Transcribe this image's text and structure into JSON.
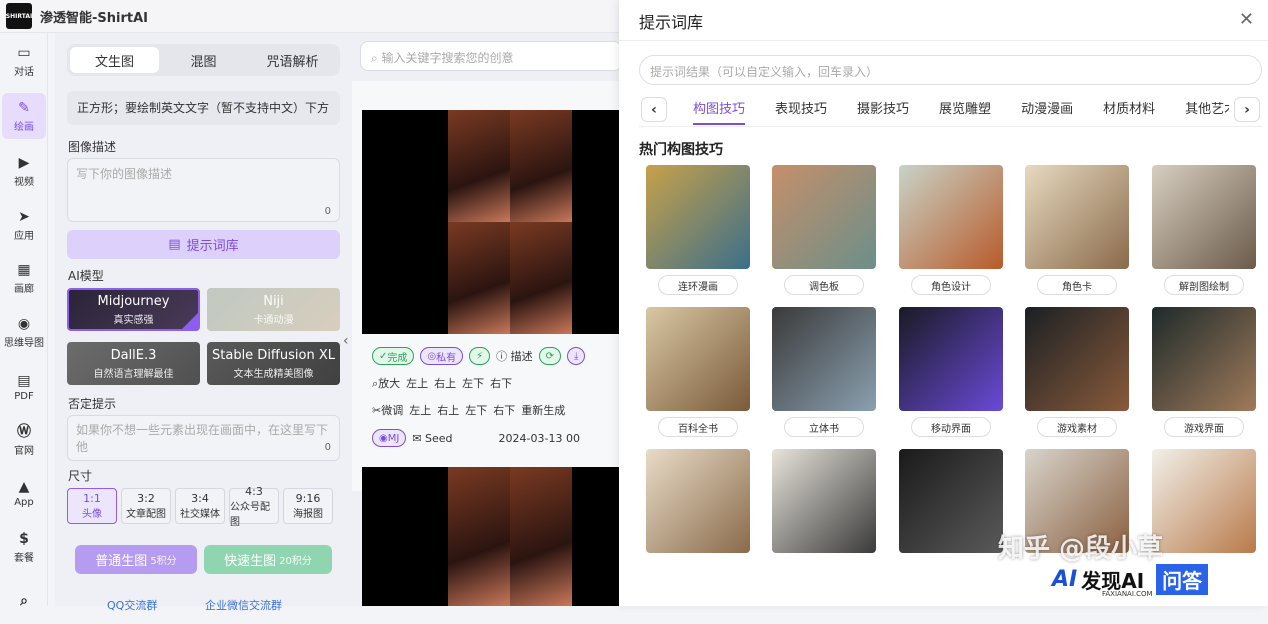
{
  "app": {
    "title": "渗透智能-ShirtAI",
    "logo_text": "SHIRTAI"
  },
  "nav": [
    {
      "label": "对话",
      "icon": "chat-icon",
      "glyph": "▭"
    },
    {
      "label": "绘画",
      "icon": "brush-icon",
      "glyph": "✎"
    },
    {
      "label": "视频",
      "icon": "video-icon",
      "glyph": "▶"
    },
    {
      "label": "应用",
      "icon": "rocket-icon",
      "glyph": "➤"
    },
    {
      "label": "画廊",
      "icon": "gallery-icon",
      "glyph": "▦"
    },
    {
      "label": "思维导图",
      "icon": "mindmap-icon",
      "glyph": "◉"
    },
    {
      "label": "PDF",
      "icon": "pdf-icon",
      "glyph": "▤"
    },
    {
      "label": "官网",
      "icon": "wordpress-icon",
      "glyph": "Ⓦ"
    },
    {
      "label": "App",
      "icon": "app-icon",
      "glyph": "▲"
    },
    {
      "label": "套餐",
      "icon": "package-icon",
      "glyph": "$"
    },
    {
      "label": "",
      "icon": "search-icon",
      "glyph": "⌕"
    }
  ],
  "panel": {
    "tabs": [
      "文生图",
      "混图",
      "咒语解析"
    ],
    "prompt_preview": "正方形；要绘制英文文字（暂不支持中文）下方",
    "image_desc_label": "图像描述",
    "image_desc_placeholder": "写下你的图像描述",
    "image_desc_count": "0",
    "library_button": "提示词库",
    "model_label": "AI模型",
    "models": [
      {
        "name": "Midjourney",
        "desc": "真实感强"
      },
      {
        "name": "Niji",
        "desc": "卡通动漫"
      },
      {
        "name": "DallE.3",
        "desc": "自然语言理解最佳"
      },
      {
        "name": "Stable Diffusion XL",
        "desc": "文本生成精美图像"
      }
    ],
    "negative_label": "否定提示",
    "negative_placeholder": "如果你不想一些元素出现在画面中，在这里写下他",
    "negative_count": "0",
    "size_label": "尺寸",
    "sizes": [
      {
        "ratio": "1:1",
        "desc": "头像"
      },
      {
        "ratio": "3:2",
        "desc": "文章配图"
      },
      {
        "ratio": "3:4",
        "desc": "社交媒体"
      },
      {
        "ratio": "4:3",
        "desc": "公众号配图"
      },
      {
        "ratio": "9:16",
        "desc": "海报图"
      }
    ],
    "gen_normal": "普通生图",
    "gen_normal_cost": "5积分",
    "gen_fast": "快速生图",
    "gen_fast_cost": "20积分",
    "contact_qq": "QQ交流群",
    "contact_wechat": "企业微信交流群"
  },
  "main": {
    "search_placeholder": "输入关键字搜索您的创意",
    "status_done": "完成",
    "status_private": "私有",
    "describe": "描述",
    "zoom": "放大",
    "finetune": "微调",
    "dirs": [
      "左上",
      "右上",
      "左下",
      "右下"
    ],
    "regen": "重新生成",
    "mj": "MJ",
    "seed": "Seed",
    "date": "2024-03-13 00"
  },
  "drawer": {
    "title": "提示词库",
    "search_placeholder": "提示词结果（可以自定义输入，回车录入）",
    "categories": [
      "构图技巧",
      "表现技巧",
      "摄影技巧",
      "展览雕塑",
      "动漫漫画",
      "材质材料",
      "其他艺术"
    ],
    "section_title": "热门构图技巧",
    "items": [
      {
        "label": "连环漫画",
        "c1": "#c8a14a",
        "c2": "#3a6f8a"
      },
      {
        "label": "调色板",
        "c1": "#c58f6a",
        "c2": "#6b8f8a"
      },
      {
        "label": "角色设计",
        "c1": "#c9d3c7",
        "c2": "#b85a2a"
      },
      {
        "label": "角色卡",
        "c1": "#e6d9c0",
        "c2": "#8a6a4a"
      },
      {
        "label": "解剖图绘制",
        "c1": "#d8cfc0",
        "c2": "#6a5a4a"
      },
      {
        "label": "百科全书",
        "c1": "#d9c7a4",
        "c2": "#7a5a3a"
      },
      {
        "label": "立体书",
        "c1": "#3a3a3a",
        "c2": "#8aa0b0"
      },
      {
        "label": "移动界面",
        "c1": "#1a1a24",
        "c2": "#6a4ad8"
      },
      {
        "label": "游戏素材",
        "c1": "#1a2024",
        "c2": "#8a5a3a"
      },
      {
        "label": "游戏界面",
        "c1": "#1e2a2a",
        "c2": "#a07a5a"
      },
      {
        "label": "",
        "c1": "#e8dcc8",
        "c2": "#8a6a4a"
      },
      {
        "label": "",
        "c1": "#e8e4dc",
        "c2": "#3a3a3a"
      },
      {
        "label": "",
        "c1": "#1a1a1a",
        "c2": "#5a5a5a"
      },
      {
        "label": "",
        "c1": "#d8d4cc",
        "c2": "#8a6040"
      },
      {
        "label": "",
        "c1": "#f2f0ea",
        "c2": "#b87a4a"
      }
    ]
  },
  "watermark": {
    "text": "知乎 @段小草",
    "brand_ai": "AI",
    "brand_name": "发现AI",
    "brand_domain": "FAXIANAI.COM",
    "brand_qa": "问答"
  },
  "colors": {
    "accent": "#7c4ddb",
    "success": "#2aa35a"
  }
}
